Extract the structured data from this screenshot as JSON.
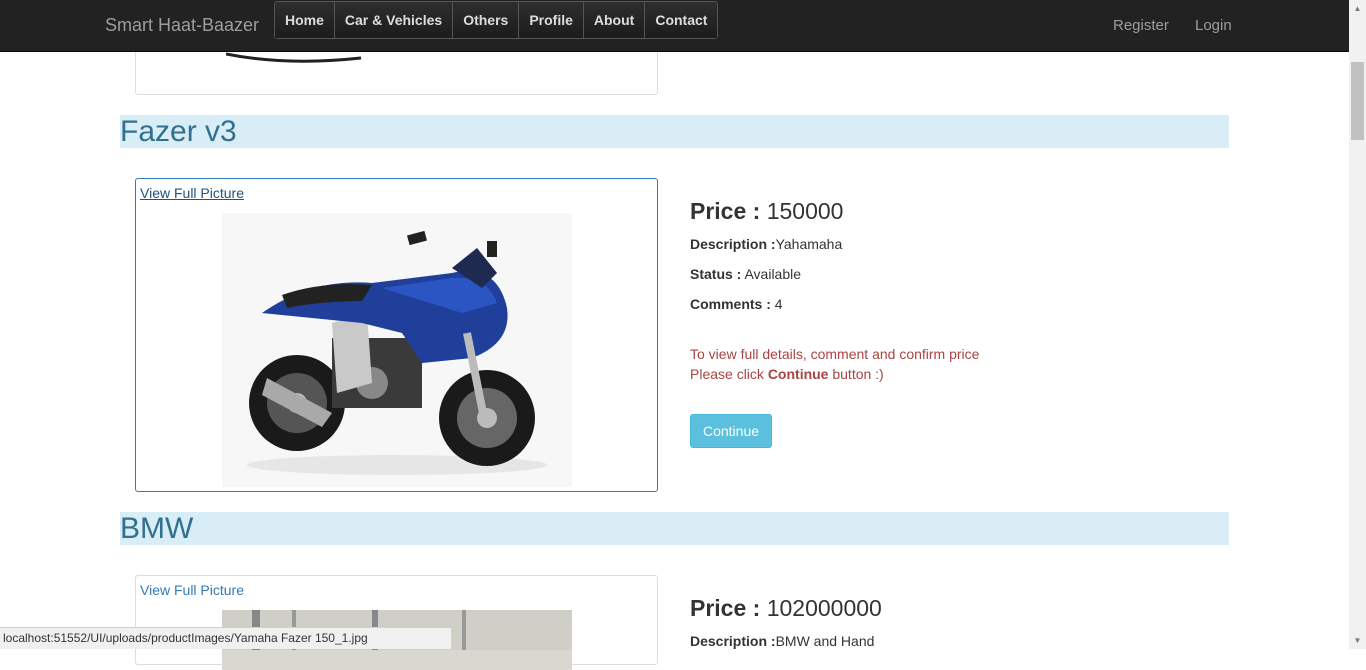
{
  "nav": {
    "brand": "Smart Haat-Baazer",
    "items": [
      "Home",
      "Car & Vehicles",
      "Others",
      "Profile",
      "About",
      "Contact"
    ],
    "register": "Register",
    "login": "Login"
  },
  "products": [
    {
      "title": "Fazer v3",
      "view_link": "View Full Picture",
      "price_label": "Price :",
      "price": "150000",
      "description_label": "Description :",
      "description": "Yahamaha",
      "status_label": "Status :",
      "status": "Available",
      "comments_label": "Comments :",
      "comments": "4",
      "notice_line1": "To view full details, comment and confirm price",
      "notice_line2_pre": "Please click ",
      "notice_line2_bold": "Continue",
      "notice_line2_post": " button :)",
      "button": "Continue"
    },
    {
      "title": "BMW",
      "view_link": "View Full Picture",
      "price_label": "Price :",
      "price": "102000000",
      "description_label": "Description :",
      "description": "BMW and Hand"
    }
  ],
  "status_bar": "localhost:51552/UI/uploads/productImages/Yamaha Fazer 150_1.jpg",
  "colors": {
    "navbar": "#222222",
    "heading_bg": "#d9edf7",
    "heading_text": "#31708f",
    "button": "#5bc0de",
    "alert": "#a94442"
  }
}
